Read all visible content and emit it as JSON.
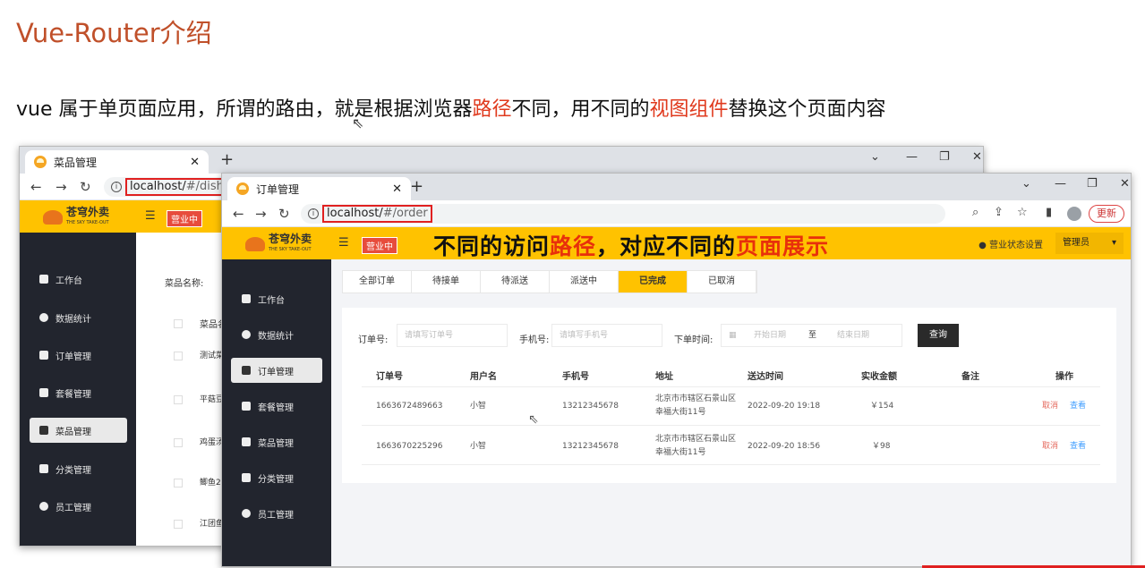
{
  "slide": {
    "title": "Vue-Router介绍",
    "subtitle_parts": [
      "vue 属于单页面应用，所谓的路由，就是根据浏览器",
      "路径",
      "不同，用不同的",
      "视图组件",
      "替换这个页面内容"
    ],
    "accent_color": "#e03a1e"
  },
  "back_window": {
    "tab_title": "菜品管理",
    "url_host": "localhost/",
    "url_path": "#/dish",
    "logo_text": "苍穹外卖",
    "logo_sub": "THE SKY TAKE-OUT",
    "status_badge": "营业中",
    "sidebar": [
      "工作台",
      "数据统计",
      "订单管理",
      "套餐管理",
      "菜品管理",
      "分类管理",
      "员工管理"
    ],
    "active_sidebar": "菜品管理",
    "filter_label": "菜品名称:",
    "rows": [
      "菜品名",
      "测试菜",
      "平菇豆",
      "鸡蛋汤",
      "鲫鱼2",
      "江团鱼"
    ]
  },
  "front_window": {
    "tab_title": "订单管理",
    "url_host": "localhost/",
    "url_path": "#/order",
    "logo_text": "苍穹外卖",
    "logo_sub": "THE SKY TAKE-OUT",
    "status_badge": "营业中",
    "banner_parts": [
      "不同的访问",
      "路径",
      "，对应不同的",
      "页面展示"
    ],
    "shop_status": "营业状态设置",
    "admin_label": "管理员",
    "update_label": "更新",
    "sidebar": [
      "工作台",
      "数据统计",
      "订单管理",
      "套餐管理",
      "菜品管理",
      "分类管理",
      "员工管理"
    ],
    "active_sidebar": "订单管理",
    "order_tabs": [
      "全部订单",
      "待接单",
      "待派送",
      "派送中",
      "已完成",
      "已取消"
    ],
    "active_order_tab": "已完成",
    "filters": {
      "order_no_label": "订单号:",
      "order_no_placeholder": "请填写订单号",
      "phone_label": "手机号:",
      "phone_placeholder": "请填写手机号",
      "time_label": "下单时间:",
      "start_placeholder": "开始日期",
      "to_label": "至",
      "end_placeholder": "结束日期",
      "query_button": "查询"
    },
    "table": {
      "headers": [
        "订单号",
        "用户名",
        "手机号",
        "地址",
        "送达时间",
        "实收金额",
        "备注",
        "操作"
      ],
      "rows": [
        {
          "order_no": "1663672489663",
          "user": "小智",
          "phone": "13212345678",
          "address_line1": "北京市市辖区石景山区",
          "address_line2": "幸福大街11号",
          "time": "2022-09-20 19:18",
          "amount": "￥154",
          "remark": "",
          "cancel": "取消",
          "view": "查看"
        },
        {
          "order_no": "1663670225296",
          "user": "小智",
          "phone": "13212345678",
          "address_line1": "北京市市辖区石景山区",
          "address_line2": "幸福大街11号",
          "time": "2022-09-20 18:56",
          "amount": "￥98",
          "remark": "",
          "cancel": "取消",
          "view": "查看"
        }
      ]
    }
  },
  "colors": {
    "brand_yellow": "#ffc200",
    "sidebar_dark": "#22252e",
    "link_blue": "#419eff",
    "cancel_red": "#e46a5e"
  }
}
